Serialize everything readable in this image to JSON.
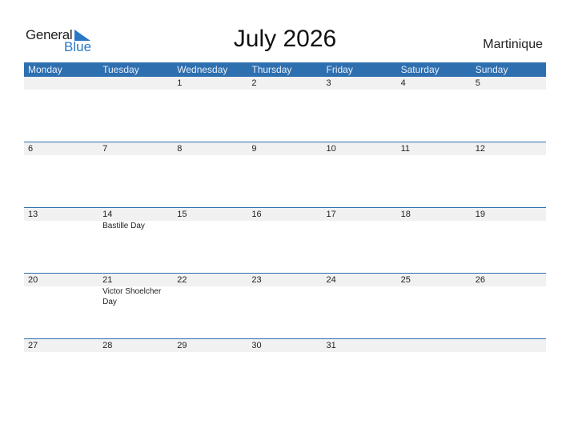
{
  "logo": {
    "word1": "General",
    "word2": "Blue",
    "accent": "#2a78c4"
  },
  "title": "July 2026",
  "country": "Martinique",
  "colors": {
    "header_bg": "#2e6fb0",
    "row_strip": "#f1f1f1"
  },
  "weekdays": [
    "Monday",
    "Tuesday",
    "Wednesday",
    "Thursday",
    "Friday",
    "Saturday",
    "Sunday"
  ],
  "weeks": [
    [
      {
        "day": ""
      },
      {
        "day": ""
      },
      {
        "day": "1"
      },
      {
        "day": "2"
      },
      {
        "day": "3"
      },
      {
        "day": "4"
      },
      {
        "day": "5"
      }
    ],
    [
      {
        "day": "6"
      },
      {
        "day": "7"
      },
      {
        "day": "8"
      },
      {
        "day": "9"
      },
      {
        "day": "10"
      },
      {
        "day": "11"
      },
      {
        "day": "12"
      }
    ],
    [
      {
        "day": "13"
      },
      {
        "day": "14",
        "event": "Bastille Day"
      },
      {
        "day": "15"
      },
      {
        "day": "16"
      },
      {
        "day": "17"
      },
      {
        "day": "18"
      },
      {
        "day": "19"
      }
    ],
    [
      {
        "day": "20"
      },
      {
        "day": "21",
        "event": "Victor Shoelcher Day"
      },
      {
        "day": "22"
      },
      {
        "day": "23"
      },
      {
        "day": "24"
      },
      {
        "day": "25"
      },
      {
        "day": "26"
      }
    ],
    [
      {
        "day": "27"
      },
      {
        "day": "28"
      },
      {
        "day": "29"
      },
      {
        "day": "30"
      },
      {
        "day": "31"
      },
      {
        "day": ""
      },
      {
        "day": ""
      }
    ]
  ]
}
